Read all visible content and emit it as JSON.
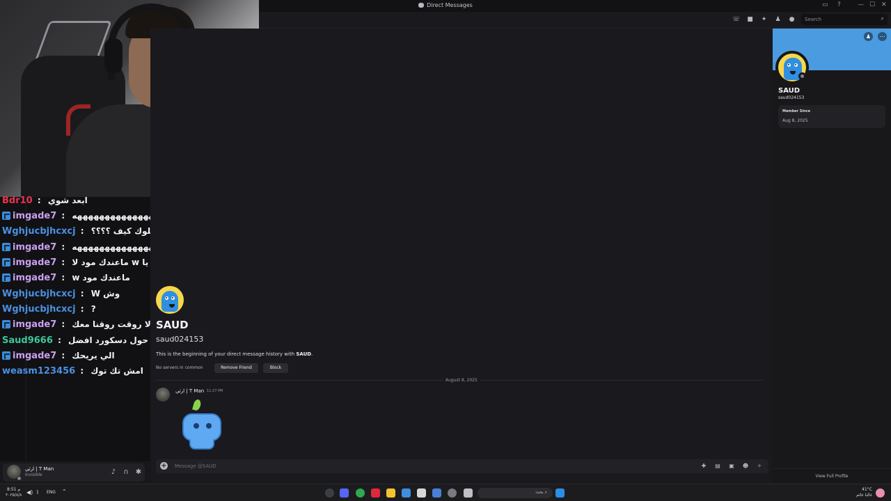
{
  "window": {
    "title": "Direct Messages",
    "controls": [
      "—",
      "☐",
      "✕"
    ]
  },
  "header": {
    "search_placeholder": "Search",
    "icons": [
      "phone-icon",
      "video-icon",
      "pin-icon",
      "add-friends-icon",
      "user-profile-icon"
    ]
  },
  "chat_overlay": {
    "lines": [
      {
        "user": "Bdr10",
        "color": "#e8324f",
        "badge": false,
        "sep": " : ",
        "text": "ابعد شوي"
      },
      {
        "user": "imgade7",
        "color": "#c9a0f0",
        "badge": true,
        "sep": " : ",
        "text": "هههههههههههههههه"
      },
      {
        "user": "Wghjucbjhcxcj",
        "color": "#4a90e2",
        "badge": false,
        "sep": " : ",
        "text": "بدر ترا اقدر اعطيك بلوك كيف ؟؟؟؟"
      },
      {
        "user": "imgade7",
        "color": "#c9a0f0",
        "badge": true,
        "sep": " : ",
        "text": "هههههههههههههههههههههههههههههه"
      },
      {
        "user": "imgade7",
        "color": "#c9a0f0",
        "badge": true,
        "sep": " : ",
        "text": "يا w ماعندك مود لا"
      },
      {
        "user": "imgade7",
        "color": "#c9a0f0",
        "badge": true,
        "sep": " : ",
        "text": "w ماعندك مود"
      },
      {
        "user": "Wghjucbjhcxcj",
        "color": "#4a90e2",
        "badge": false,
        "sep": " : ",
        "text": "W وش"
      },
      {
        "user": "Wghjucbjhcxcj",
        "color": "#4a90e2",
        "badge": false,
        "sep": " : ",
        "text": "?"
      },
      {
        "user": "imgade7",
        "color": "#c9a0f0",
        "badge": true,
        "sep": " : ",
        "text": "كنك يارجال انت لا روقت روقنا معك"
      },
      {
        "user": "Saud9666",
        "color": "#3fc79a",
        "badge": false,
        "sep": " : ",
        "text": "حول دسكورد افضل"
      },
      {
        "user": "imgade7",
        "color": "#c9a0f0",
        "badge": true,
        "sep": " : ",
        "text": "الي يريحك"
      },
      {
        "user": "weasm123456",
        "color": "#4a90e2",
        "badge": false,
        "sep": " : ",
        "text": "امش تك توك"
      }
    ]
  },
  "user_panel": {
    "username": "ارثي | T Man",
    "status": "Invisible"
  },
  "dm_intro": {
    "display_name": "SAUD",
    "handle": "saud024153",
    "description_prefix": "This is the beginning of your direct message history with ",
    "description_name": "SAUD",
    "description_suffix": ".",
    "mutual": "No servers in common",
    "remove_friend": "Remove Friend",
    "block": "Block"
  },
  "messages": {
    "date_divider": "August 8, 2025",
    "items": [
      {
        "author": "ارثي | T Man",
        "time": "11:27 PM",
        "type": "sticker"
      }
    ]
  },
  "composer": {
    "placeholder": "Message @SAUD"
  },
  "profile": {
    "display_name": "SAUD",
    "handle": "saud024153",
    "member_since_label": "Member Since",
    "member_since": "Aug 8, 2025",
    "view_full": "View Full Profile",
    "banner_color": "#4a9be0"
  },
  "taskbar": {
    "weather": "41°C",
    "weather_sub": "غالبا غائم",
    "lang": "ENG",
    "time": "8:51 م",
    "date": "٢٠٢٥/٨/٨",
    "search_text": "بحث"
  },
  "colors": {
    "accent": "#5865f2",
    "background": "#1a1a1e"
  }
}
